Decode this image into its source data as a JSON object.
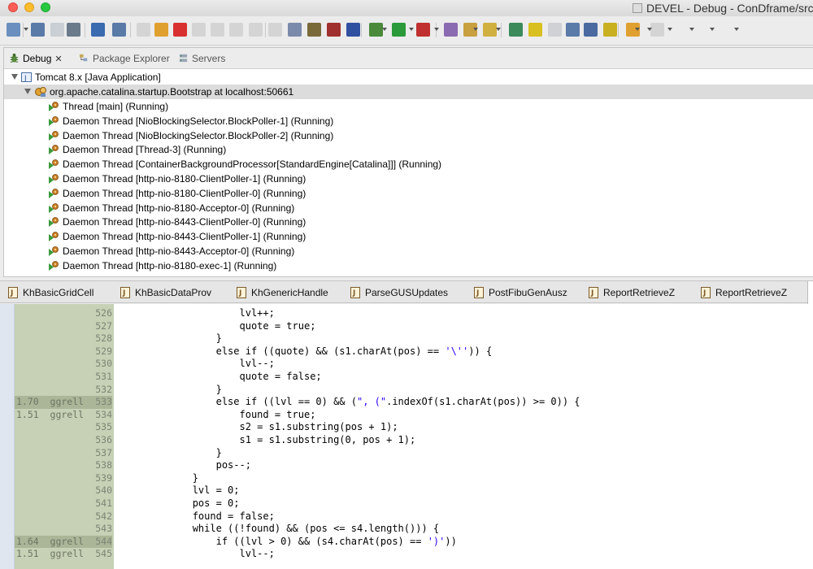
{
  "window": {
    "title": "DEVEL - Debug - ConDframe/src"
  },
  "toolbar": {
    "icons": [
      "new-icon",
      "save-icon",
      "save-all-icon",
      "print-icon",
      "debug-perspective-icon",
      "skip-breakpoints-icon",
      "resume-icon",
      "suspend-icon",
      "terminate-icon",
      "disconnect-icon",
      "step-into-icon",
      "step-over-icon",
      "step-return-icon",
      "drop-to-frame-icon",
      "use-step-filters-icon",
      "breakpoint-icon",
      "breakpoint-remove-icon",
      "breakpoint-remove-all-icon",
      "debug-run-icon",
      "run-icon",
      "external-tools-icon",
      "open-type-icon",
      "open-task-icon",
      "search-icon",
      "annotation-icon",
      "toggle-highlight-icon",
      "show-whitespace-icon",
      "block-selection-icon",
      "next-annotation-icon",
      "prev-annotation-icon",
      "back-icon",
      "forward-icon"
    ]
  },
  "views": {
    "tabs": [
      {
        "label": "Debug",
        "active": true,
        "icon": "bug-icon"
      },
      {
        "label": "Package Explorer",
        "active": false,
        "icon": "package-explorer-icon"
      },
      {
        "label": "Servers",
        "active": false,
        "icon": "servers-icon"
      }
    ]
  },
  "debug_tree": {
    "launch": "Tomcat 8.x [Java Application]",
    "process": "org.apache.catalina.startup.Bootstrap at localhost:50661",
    "threads": [
      "Thread [main] (Running)",
      "Daemon Thread [NioBlockingSelector.BlockPoller-1] (Running)",
      "Daemon Thread [NioBlockingSelector.BlockPoller-2] (Running)",
      "Daemon Thread [Thread-3] (Running)",
      "Daemon Thread [ContainerBackgroundProcessor[StandardEngine[Catalina]]] (Running)",
      "Daemon Thread [http-nio-8180-ClientPoller-1] (Running)",
      "Daemon Thread [http-nio-8180-ClientPoller-0] (Running)",
      "Daemon Thread [http-nio-8180-Acceptor-0] (Running)",
      "Daemon Thread [http-nio-8443-ClientPoller-0] (Running)",
      "Daemon Thread [http-nio-8443-ClientPoller-1] (Running)",
      "Daemon Thread [http-nio-8443-Acceptor-0] (Running)",
      "Daemon Thread [http-nio-8180-exec-1] (Running)"
    ]
  },
  "editor_tabs": [
    {
      "label": "KhBasicGridCell"
    },
    {
      "label": "KhBasicDataProv"
    },
    {
      "label": "KhGenericHandle"
    },
    {
      "label": "ParseGUSUpdates"
    },
    {
      "label": "PostFibuGenAusz"
    },
    {
      "label": "ReportRetrieveZ"
    },
    {
      "label": "ReportRetrieveZ"
    }
  ],
  "editor": {
    "lines": [
      {
        "num": "526",
        "ann": "",
        "hl": false,
        "code": "                    lvl++;"
      },
      {
        "num": "527",
        "ann": "",
        "hl": false,
        "code": "                    quote = true;"
      },
      {
        "num": "528",
        "ann": "",
        "hl": false,
        "code": "                }"
      },
      {
        "num": "529",
        "ann": "",
        "hl": false,
        "code": "                else if ((quote) && (s1.charAt(pos) == '\\'')) {"
      },
      {
        "num": "530",
        "ann": "",
        "hl": false,
        "code": "                    lvl--;"
      },
      {
        "num": "531",
        "ann": "",
        "hl": false,
        "code": "                    quote = false;"
      },
      {
        "num": "532",
        "ann": "",
        "hl": false,
        "code": "                }"
      },
      {
        "num": "533",
        "ann": "1.70  ggrell",
        "hl": true,
        "code": "                else if ((lvl == 0) && (\", (\".indexOf(s1.charAt(pos)) >= 0)) {"
      },
      {
        "num": "534",
        "ann": "1.51  ggrell",
        "hl": false,
        "code": "                    found = true;"
      },
      {
        "num": "535",
        "ann": "",
        "hl": false,
        "code": "                    s2 = s1.substring(pos + 1);"
      },
      {
        "num": "536",
        "ann": "",
        "hl": false,
        "code": "                    s1 = s1.substring(0, pos + 1);"
      },
      {
        "num": "537",
        "ann": "",
        "hl": false,
        "code": "                }"
      },
      {
        "num": "538",
        "ann": "",
        "hl": false,
        "code": "                pos--;"
      },
      {
        "num": "539",
        "ann": "",
        "hl": false,
        "code": "            }"
      },
      {
        "num": "540",
        "ann": "",
        "hl": false,
        "code": "            lvl = 0;"
      },
      {
        "num": "541",
        "ann": "",
        "hl": false,
        "code": "            pos = 0;"
      },
      {
        "num": "542",
        "ann": "",
        "hl": false,
        "code": "            found = false;"
      },
      {
        "num": "543",
        "ann": "",
        "hl": false,
        "code": "            while ((!found) && (pos <= s4.length())) {"
      },
      {
        "num": "544",
        "ann": "1.64  ggrell",
        "hl": true,
        "code": "                if ((lvl > 0) && (s4.charAt(pos) == ')'))"
      },
      {
        "num": "545",
        "ann": "1.51  ggrell",
        "hl": false,
        "code": "                    lvl--;"
      }
    ]
  }
}
